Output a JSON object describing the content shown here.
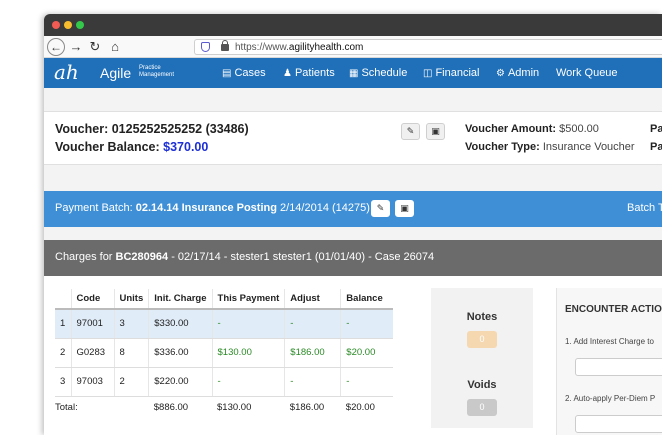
{
  "browser": {
    "url_prefix": "https://www.",
    "url_domain": "agilityhealth.com"
  },
  "app": {
    "logo_mark": "ah",
    "logo_name": "Agile",
    "logo_sub_1": "Practice",
    "logo_sub_2": "Management",
    "nav": [
      {
        "label": "Cases",
        "icon": "cases-icon"
      },
      {
        "label": "Patients",
        "icon": "patients-icon"
      },
      {
        "label": "Schedule",
        "icon": "calendar-icon"
      },
      {
        "label": "Financial",
        "icon": "financial-icon"
      },
      {
        "label": "Admin",
        "icon": "gears-icon"
      },
      {
        "label": "Work Queue",
        "icon": ""
      }
    ]
  },
  "voucher": {
    "title_label": "Voucher:",
    "title_value": "0125252525252 (33486)",
    "balance_label": "Voucher Balance:",
    "balance_value": "$370.00",
    "amount_label": "Voucher Amount:",
    "amount_value": "$500.00",
    "type_label": "Voucher Type:",
    "type_value": "Insurance Voucher",
    "right_1": "Pa",
    "right_2": "Pa"
  },
  "batch": {
    "label": "Payment Batch:",
    "name": "02.14.14 Insurance Posting",
    "detail": "2/14/2014 (14275)",
    "right": "Batch T"
  },
  "charges": {
    "prefix": "Charges for",
    "code": "BC280964",
    "rest": " - 02/17/14 - stester1 stester1 (01/01/40) - Case 26074"
  },
  "table": {
    "headers": [
      "",
      "Code",
      "Units",
      "Init. Charge",
      "This Payment",
      "Adjust",
      "Balance"
    ],
    "rows": [
      [
        "1",
        "97001",
        "3",
        "$330.00",
        "-",
        "-",
        "-"
      ],
      [
        "2",
        "G0283",
        "8",
        "$336.00",
        "$130.00",
        "$186.00",
        "$20.00"
      ],
      [
        "3",
        "97003",
        "2",
        "$220.00",
        "-",
        "-",
        "-"
      ]
    ],
    "total_label": "Total:",
    "totals": [
      "$886.00",
      "$130.00",
      "$186.00",
      "$20.00"
    ]
  },
  "notes": {
    "notes_label": "Notes",
    "notes_count": "0",
    "voids_label": "Voids",
    "voids_count": "0"
  },
  "encounter": {
    "title": "ENCOUNTER ACTIO",
    "action_1": "1. Add Interest Charge to",
    "action_2": "2. Auto-apply Per-Diem P"
  },
  "colors": {
    "nav_bg": "#1f6fb9",
    "batch_bg": "#3e8fd6",
    "charges_bg": "#6b6b6b",
    "balance_accent": "#1c2fd4",
    "paid_green": "#2a8a25"
  }
}
